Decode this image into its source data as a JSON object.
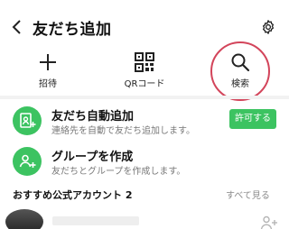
{
  "header": {
    "title": "友だち追加"
  },
  "quick_actions": [
    {
      "label": "招待",
      "icon": "plus-icon"
    },
    {
      "label": "QRコード",
      "icon": "qr-code-icon"
    },
    {
      "label": "検索",
      "icon": "search-icon"
    }
  ],
  "auto_add": {
    "title": "友だち自動追加",
    "subtitle": "連絡先を自動で友だち追加します。",
    "button": "許可する"
  },
  "create_group": {
    "title": "グループを作成",
    "subtitle": "友だちとグループを作成します。"
  },
  "official_accounts": {
    "title": "おすすめ公式アカウント 2",
    "see_all": "すべて見る"
  },
  "colors": {
    "accent_green": "#3cc361",
    "highlight_ring": "#d3455b"
  }
}
